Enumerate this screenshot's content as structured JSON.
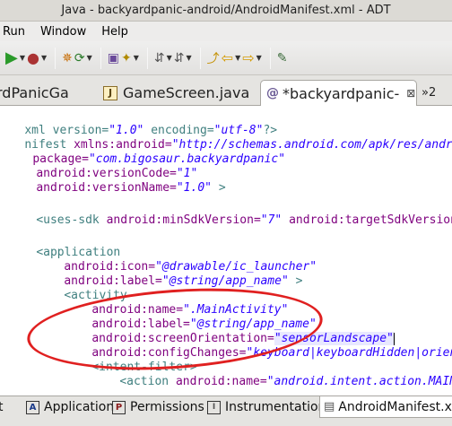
{
  "window": {
    "title": "Java - backyardpanic-android/AndroidManifest.xml - ADT"
  },
  "menu": {
    "items": [
      "Run",
      "Window",
      "Help"
    ]
  },
  "toolbar": {
    "icons": [
      "run-icon",
      "debug-icon",
      "new-icon",
      "refresh-icon",
      "package-icon",
      "wand-icon",
      "nav-icon",
      "back-icon",
      "forward-icon",
      "edit-icon"
    ]
  },
  "tabs": {
    "items": [
      {
        "label": "rdPanicGa"
      },
      {
        "label": "GameScreen.java"
      },
      {
        "label": "*backyardpanic-"
      }
    ],
    "overflow": "»2"
  },
  "code": {
    "l1": {
      "a": "xml version=",
      "b": "\"1.0\"",
      "c": " encoding=",
      "d": "\"utf-8\"",
      "e": "?>"
    },
    "l2": {
      "a": "nifest ",
      "b": "xmlns:android=",
      "c": "\"http://schemas.android.com/apk/res/android\""
    },
    "l3": {
      "a": "package=",
      "b": "\"com.bigosaur.backyardpanic\""
    },
    "l4": {
      "a": "android:versionCode=",
      "b": "\"1\""
    },
    "l5": {
      "a": "android:versionName=",
      "b": "\"1.0\"",
      "c": " >"
    },
    "l6": {
      "a": "<uses-sdk ",
      "b": "android:minSdkVersion=",
      "c": "\"7\"",
      "d": " android:targetSdkVersion=",
      "e": "\""
    },
    "l7": {
      "a": "<application"
    },
    "l8": {
      "a": "android:icon=",
      "b": "\"@drawable/ic_launcher\""
    },
    "l9": {
      "a": "android:label=",
      "b": "\"@string/app_name\"",
      "c": " >"
    },
    "l10": {
      "a": "<activity"
    },
    "l11": {
      "a": "android:name=",
      "b": "\".MainActivity\""
    },
    "l12": {
      "a": "android:label=",
      "b": "\"@string/app_name\""
    },
    "l13": {
      "a": "android:screenOrientation=",
      "b": "\"sensorLandscape\""
    },
    "l14": {
      "a": "android:configChanges=",
      "b": "\"keyboard|keyboardHidden|orientation\""
    },
    "l15": {
      "a": "<intent-filter>"
    },
    "l16": {
      "a": "<action ",
      "b": "android:name=",
      "c": "\"android.intent.action.MAIN\""
    }
  },
  "bottom_tabs": {
    "items": [
      {
        "icon": "A",
        "label": "Application"
      },
      {
        "icon": "P",
        "label": "Permissions"
      },
      {
        "icon": "I",
        "label": "Instrumentation"
      },
      {
        "label": "AndroidManifest.xml"
      }
    ]
  },
  "colors": {
    "tag": "#3f7f7f",
    "attribute": "#7f007f",
    "value": "#2a00ff",
    "annotation": "#e02020"
  }
}
